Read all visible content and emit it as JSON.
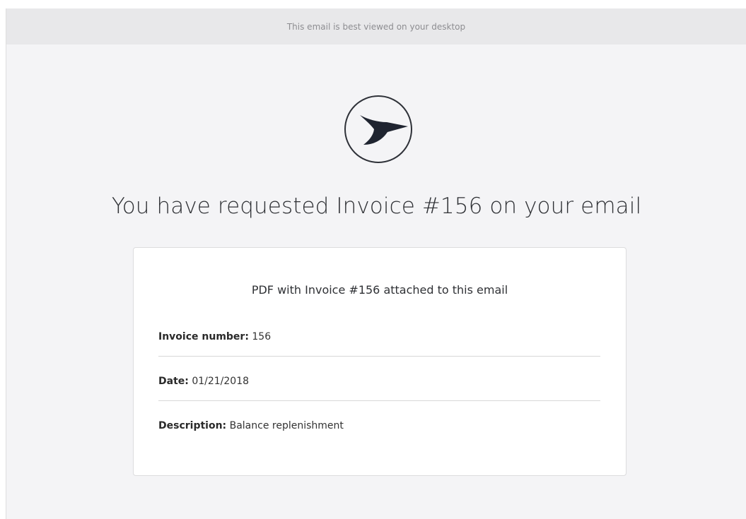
{
  "topbar": {
    "text": "This email is best viewed on your desktop"
  },
  "logo": {
    "icon": "hummingbird-icon"
  },
  "headline": "You have requested Invoice #156 on your email",
  "card": {
    "title": "PDF with Invoice #156 attached to this email",
    "rows": [
      {
        "label": "Invoice number:",
        "value": "156"
      },
      {
        "label": "Date:",
        "value": "01/21/2018"
      },
      {
        "label": "Description:",
        "value": "Balance replenishment"
      }
    ]
  },
  "colors": {
    "page_bg": "#f4f4f6",
    "topbar_bg": "#e8e8ea",
    "text": "#2f3135",
    "muted": "#8d8d91",
    "card_border": "#dcdcde"
  }
}
